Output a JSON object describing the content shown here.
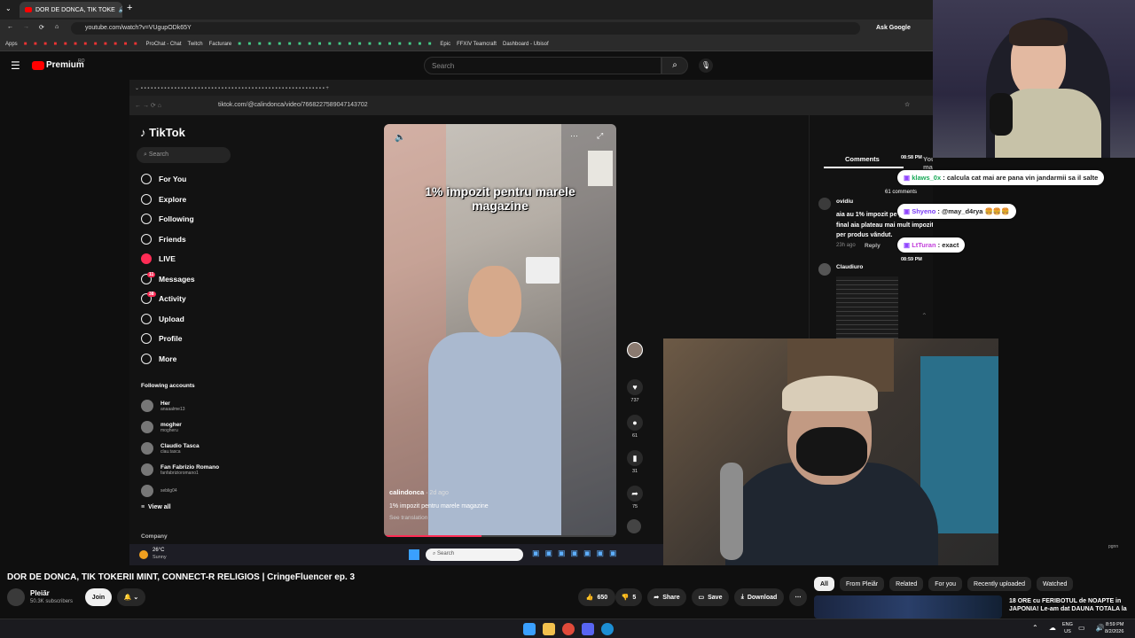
{
  "browser": {
    "active_tab": "DOR DE DONCA, TIK TOKE",
    "url": "youtube.com/watch?v=VUgupODk65Y",
    "ask_google": "Ask Google",
    "bookmarks": [
      "Apps",
      "ProChat - Chat",
      "Twitch",
      "Facturare",
      "Epic",
      "FFXIV Teamcraft",
      "Dashboard - Ubisof"
    ]
  },
  "yt_header": {
    "brand": "Premium",
    "region": "RO",
    "search_placeholder": "Search"
  },
  "inner_browser": {
    "url": "tiktok.com/@calindonca/video/7668227589047143702"
  },
  "tiktok": {
    "logo": "TikTok",
    "search_placeholder": "Search",
    "nav": [
      {
        "label": "For You",
        "icon": "home-icon"
      },
      {
        "label": "Explore",
        "icon": "compass-icon"
      },
      {
        "label": "Following",
        "icon": "following-icon"
      },
      {
        "label": "Friends",
        "icon": "friends-icon"
      },
      {
        "label": "LIVE",
        "icon": "live-icon"
      },
      {
        "label": "Messages",
        "icon": "messages-icon",
        "badge": "11"
      },
      {
        "label": "Activity",
        "icon": "activity-icon",
        "badge": "38"
      },
      {
        "label": "Upload",
        "icon": "upload-icon"
      },
      {
        "label": "Profile",
        "icon": "profile-icon"
      },
      {
        "label": "More",
        "icon": "more-icon"
      }
    ],
    "following_heading": "Following accounts",
    "accounts": [
      {
        "name": "Her",
        "handle": "anaaalme13"
      },
      {
        "name": "mogher",
        "handle": "mogheru"
      },
      {
        "name": "Claudio Tasca",
        "handle": "clau.tasca"
      },
      {
        "name": "Fan Fabrizio Romano",
        "handle": "fanfabrizioromano1"
      },
      {
        "name": "",
        "handle": "seblig04"
      }
    ],
    "view_all": "View all",
    "company": "Company",
    "video": {
      "caption": "1% impozit pentru marele magazine",
      "username": "calindonca",
      "posted": "2d ago",
      "description": "1% impozit pentru marele magazine",
      "see_translation": "See translation",
      "progress": 0.42
    },
    "actions": [
      {
        "name": "like",
        "glyph": "♥",
        "count": "737"
      },
      {
        "name": "comment",
        "glyph": "●",
        "count": "61"
      },
      {
        "name": "save",
        "glyph": "▮",
        "count": "31"
      },
      {
        "name": "share",
        "glyph": "➦",
        "count": "75"
      }
    ],
    "comments_tab": "Comments",
    "you_may_like_tab": "You may like",
    "comments_count": "61 comments",
    "comments": [
      {
        "user": "ovidiu",
        "text": "aia au 1% impozit pe profit, la final aia plateau mai mult impozit per produs vândut.",
        "time": "23h ago",
        "reply": "Reply",
        "likes": "0"
      },
      {
        "user": "Claudiuro",
        "text": "",
        "time": "",
        "reply": "",
        "likes": ""
      }
    ]
  },
  "chat": [
    {
      "time": "08:58 PM",
      "user": "klaws_0x",
      "text": "calcula cat mai are pana vin jandarmii sa il salte"
    },
    {
      "time": "",
      "user": "Shyeno",
      "text": "@may_d4rya 🍔🍔🍔"
    },
    {
      "time": "08:59 PM",
      "user": "LtTuran",
      "text": "exact"
    }
  ],
  "inner_taskbar": {
    "weather_temp": "26°C",
    "weather_desc": "Sunny",
    "search_placeholder": "Search"
  },
  "youtube": {
    "video_title": "DOR DE DONCA, TIK TOKERII MINT, CONNECT-R RELIGIOS | CringeFluencer ep. 3",
    "channel_name": "Pleiăr",
    "subscribers": "50.3K subscribers",
    "join": "Join",
    "likes": "650",
    "dislikes": "5",
    "share": "Share",
    "save": "Save",
    "download": "Download",
    "chips": [
      "All",
      "From Pleiăr",
      "Related",
      "For you",
      "Recently uploaded",
      "Watched"
    ],
    "rec_title": "18 ORE cu FERIBOTUL de NOAPTE in JAPONIA! Le-am dat DAUNA TOTALA la",
    "watermark": "pgnn"
  },
  "system": {
    "lang": "ENG",
    "region": "US",
    "time": "8:59 PM",
    "date": "8/2/2026"
  },
  "colors": {
    "yt_red": "#ff0000",
    "tiktok_pink": "#fe2c55",
    "chat_green": "#18a957"
  }
}
